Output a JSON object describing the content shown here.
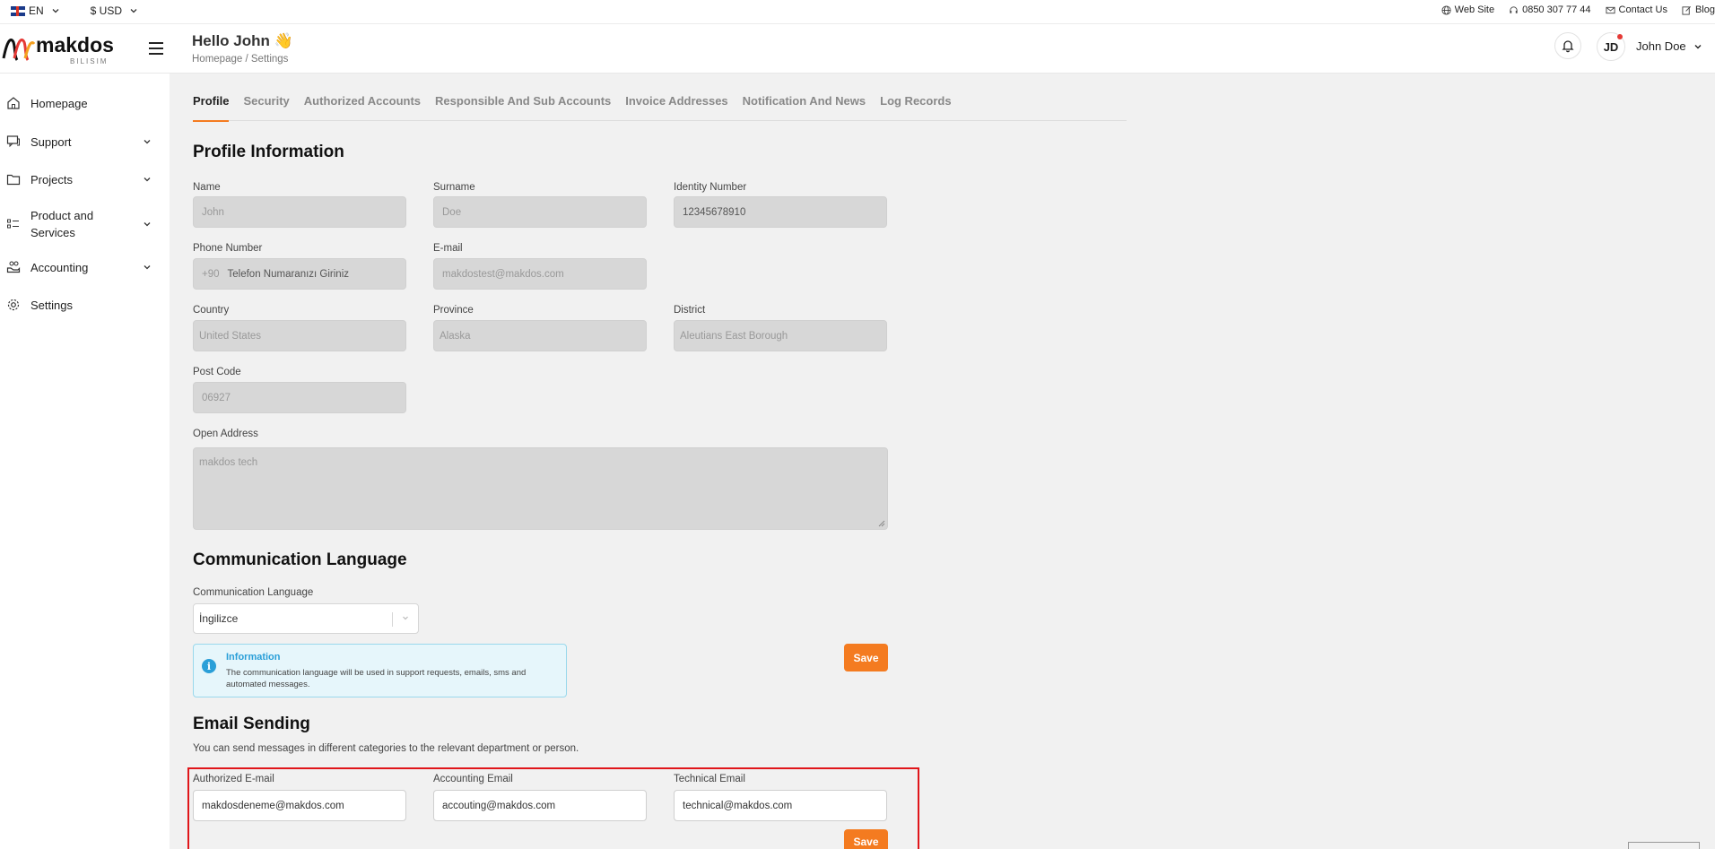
{
  "topbar": {
    "language": "EN",
    "currency": "$ USD",
    "links": {
      "website": "Web Site",
      "phone": "0850 307 77 44",
      "contact": "Contact Us",
      "blog": "Blog"
    }
  },
  "header": {
    "greeting": "Hello John 👋",
    "breadcrumb": {
      "home": "Homepage",
      "separator": "/",
      "current": "Settings"
    },
    "avatar_initials": "JD",
    "user_name": "John Doe"
  },
  "logo": {
    "text": "makdos",
    "subtext": "BILISIM"
  },
  "sidebar": {
    "items": [
      {
        "label": "Homepage",
        "icon": "home-icon"
      },
      {
        "label": "Support",
        "icon": "chat-icon"
      },
      {
        "label": "Projects",
        "icon": "folder-icon"
      },
      {
        "label": "Product and Services",
        "icon": "list-icon"
      },
      {
        "label": "Accounting",
        "icon": "hand-coins-icon"
      },
      {
        "label": "Settings",
        "icon": "gear-icon"
      }
    ]
  },
  "tabs": [
    "Profile",
    "Security",
    "Authorized Accounts",
    "Responsible And Sub Accounts",
    "Invoice Addresses",
    "Notification And News",
    "Log Records"
  ],
  "profile": {
    "title": "Profile Information",
    "name": {
      "label": "Name",
      "value": "John"
    },
    "surname": {
      "label": "Surname",
      "value": "Doe"
    },
    "identity": {
      "label": "Identity Number",
      "value": "12345678910"
    },
    "phone": {
      "label": "Phone Number",
      "prefix": "+90",
      "value": "Telefon Numaranızı Giriniz"
    },
    "email": {
      "label": "E-mail",
      "value": "makdostest@makdos.com"
    },
    "country": {
      "label": "Country",
      "value": "United States"
    },
    "province": {
      "label": "Province",
      "value": "Alaska"
    },
    "district": {
      "label": "District",
      "value": "Aleutians East Borough"
    },
    "postcode": {
      "label": "Post Code",
      "value": "06927"
    },
    "address": {
      "label": "Open Address",
      "value": "makdos tech"
    }
  },
  "communication": {
    "title": "Communication Language",
    "label": "Communication Language",
    "selected": "İngilizce",
    "info_title": "Information",
    "info_text": "The communication language will be used in support requests, emails, sms and automated messages.",
    "save": "Save"
  },
  "email_sending": {
    "title": "Email Sending",
    "description": "You can send messages in different categories to the relevant department or person.",
    "authorized": {
      "label": "Authorized E-mail",
      "value": "makdosdeneme@makdos.com"
    },
    "accounting": {
      "label": "Accounting Email",
      "value": "accouting@makdos.com"
    },
    "technical": {
      "label": "Technical Email",
      "value": "technical@makdos.com"
    },
    "save": "Save"
  },
  "colors": {
    "accent": "#f47b20",
    "info": "#2a9fd8",
    "highlight": "#e0161a"
  }
}
